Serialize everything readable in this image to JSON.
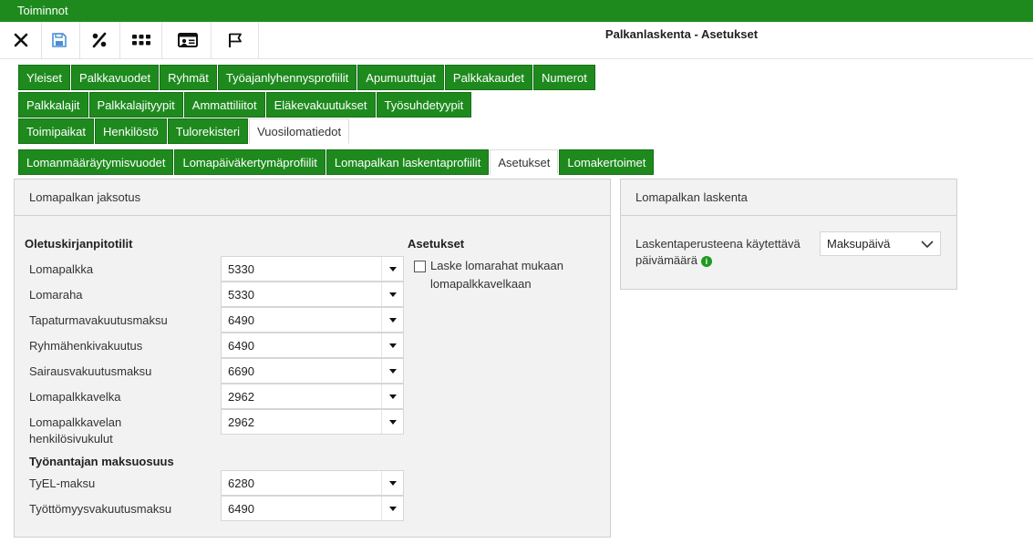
{
  "topbar": {
    "menu_label": "Toiminnot"
  },
  "toolbar": {
    "title": "Palkanlaskenta - Asetukset",
    "buttons": [
      {
        "icon": "close-icon"
      },
      {
        "icon": "save-icon"
      },
      {
        "icon": "percent-icon"
      },
      {
        "icon": "grid-dots-icon"
      },
      {
        "icon": "id-card-icon"
      },
      {
        "icon": "flag-icon"
      }
    ]
  },
  "tabs": {
    "row1": [
      "Yleiset",
      "Palkkavuodet",
      "Ryhmät",
      "Työajanlyhennysprofiilit",
      "Apumuuttujat",
      "Palkkakaudet",
      "Numerot"
    ],
    "row2": [
      "Palkkalajit",
      "Palkkalajityypit",
      "Ammattiliitot",
      "Eläkevakuutukset",
      "Työsuhdetyypit"
    ],
    "row3": [
      "Toimipaikat",
      "Henkilöstö",
      "Tulorekisteri",
      "Vuosilomatiedot"
    ],
    "row4": [
      "Lomanmääräytymisvuodet",
      "Lomapäiväkertymäprofiilit",
      "Lomapalkan laskentaprofiilit",
      "Asetukset",
      "Lomakertoimet"
    ]
  },
  "left_panel": {
    "title": "Lomapalkan jaksotus",
    "default_accounts_heading": "Oletuskirjanpitotilit",
    "rows": [
      {
        "label": "Lomapalkka",
        "value": "5330"
      },
      {
        "label": "Lomaraha",
        "value": "5330"
      },
      {
        "label": "Tapaturmavakuutusmaksu",
        "value": "6490"
      },
      {
        "label": "Ryhmähenkivakuutus",
        "value": "6490"
      },
      {
        "label": "Sairausvakuutusmaksu",
        "value": "6690"
      },
      {
        "label": "Lomapalkkavelka",
        "value": "2962"
      },
      {
        "label": "Lomapalkkavelan henkilösivukulut",
        "value": "2962"
      }
    ],
    "employer_heading": "Työnantajan maksuosuus",
    "employer_rows": [
      {
        "label": "TyEL-maksu",
        "value": "6280"
      },
      {
        "label": "Työttömyysvakuutusmaksu",
        "value": "6490"
      }
    ],
    "settings_heading": "Asetukset",
    "checkbox_label": "Laske lomarahat mukaan lomapalkkavelkaan"
  },
  "right_panel": {
    "title": "Lomapalkan laskenta",
    "field_label": "Laskentaperusteena käytettävä päivämäärä",
    "field_value": "Maksupäivä"
  },
  "colors": {
    "brand_green": "#1e8a1e",
    "save_icon": "#4a8fd4"
  }
}
